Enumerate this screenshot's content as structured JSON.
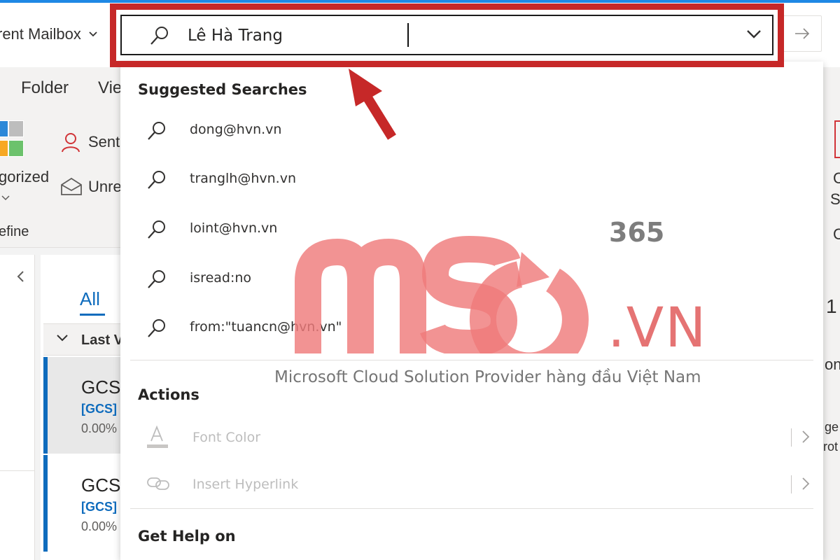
{
  "header": {
    "scope_label": "rent Mailbox"
  },
  "tabs": {
    "folder": "Folder",
    "view": "Vie"
  },
  "ribbon": {
    "categorized": "gorized",
    "sent": "Sent",
    "unread": "Unre",
    "define": "efine"
  },
  "mail_list": {
    "all_tab": "All",
    "group_header": "Last V",
    "items": [
      {
        "from": "GCS",
        "subject": "[GCS]",
        "preview": "0.00%"
      },
      {
        "from": "GCS",
        "subject": "[GCS]",
        "preview": "0.00%"
      }
    ]
  },
  "right_pane": {
    "c1": "C",
    "c2": "S",
    "c3": "C",
    "num": "1",
    "t1": "on",
    "t2": "ge",
    "t3": "rot"
  },
  "search": {
    "value": "Lê Hà Trang"
  },
  "dropdown": {
    "suggested_title": "Suggested Searches",
    "suggestions": [
      {
        "label": "dong@hvn.vn"
      },
      {
        "label": "tranglh@hvn.vn"
      },
      {
        "label": "loint@hvn.vn"
      },
      {
        "label": "isread:no"
      },
      {
        "label": "from:\"tuancn@hvn.vn\""
      }
    ],
    "actions_title": "Actions",
    "actions": [
      {
        "label": "Font Color",
        "icon": "font-color-icon"
      },
      {
        "label": "Insert Hyperlink",
        "icon": "link-icon"
      }
    ],
    "help_title": "Get Help on"
  },
  "watermark": {
    "logo": "MSO",
    "sup": "365",
    "domain": ".VN",
    "tagline": "Microsoft Cloud Solution Provider hàng đầu Việt Nam"
  },
  "colors": {
    "highlight": "#c62828",
    "accent": "#0f6cbd",
    "watermark": "#e57373"
  }
}
